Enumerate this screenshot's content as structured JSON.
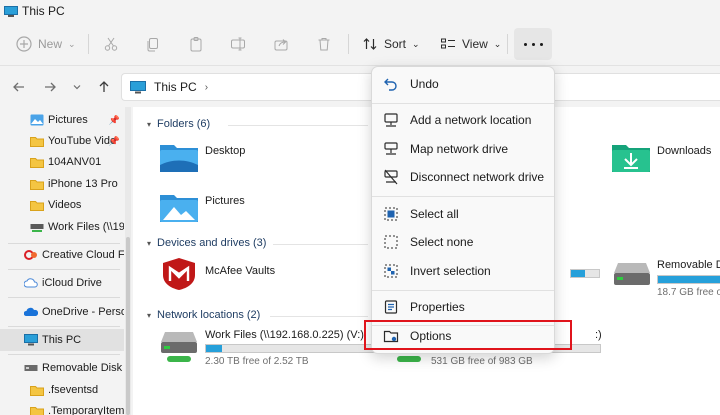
{
  "window": {
    "title": "This PC"
  },
  "toolbar": {
    "new_label": "New",
    "sort_label": "Sort",
    "view_label": "View"
  },
  "address": {
    "crumb": "This PC"
  },
  "sidebar": {
    "items": [
      {
        "label": "Pictures",
        "icon": "pictures-folder-icon"
      },
      {
        "label": "YouTube Vide",
        "icon": "folder-icon"
      },
      {
        "label": "104ANV01",
        "icon": "folder-icon"
      },
      {
        "label": "iPhone 13 Pro",
        "icon": "folder-icon"
      },
      {
        "label": "Videos",
        "icon": "folder-icon"
      },
      {
        "label": "Work Files (\\\\192",
        "icon": "network-drive-icon"
      },
      {
        "label": "Creative Cloud Fil",
        "icon": "creative-cloud-icon"
      },
      {
        "label": "iCloud Drive",
        "icon": "icloud-icon"
      },
      {
        "label": "OneDrive - Persor",
        "icon": "onedrive-icon"
      },
      {
        "label": "This PC",
        "icon": "this-pc-icon"
      },
      {
        "label": "Removable Disk (I",
        "icon": "removable-disk-icon"
      },
      {
        "label": ".fseventsd",
        "icon": "folder-icon"
      },
      {
        "label": ".TemporaryItems",
        "icon": "folder-icon"
      }
    ]
  },
  "content": {
    "folders_header": "Folders (6)",
    "devices_header": "Devices and drives (3)",
    "network_header": "Network locations (2)",
    "desktop": "Desktop",
    "downloads": "Downloads",
    "pictures": "Pictures",
    "mcafee": "McAfee Vaults",
    "removable": "Removable D",
    "removable_free": "18.7 GB free o",
    "removable_fill": 0.9,
    "workfiles": "Work Files (\\\\192.168.0.225) (V:)",
    "workfiles_free": "2.30 TB free of 2.52 TB",
    "workfiles_fill": 0.09,
    "drive2_name": ":)",
    "drive2_free": "531 GB free of 983 GB",
    "drive2_fill": 0.46,
    "drive_top_fill": 0.5
  },
  "menu": {
    "undo": "Undo",
    "add_network": "Add a network location",
    "map_drive": "Map network drive",
    "disconnect": "Disconnect network drive",
    "select_all": "Select all",
    "select_none": "Select none",
    "invert": "Invert selection",
    "properties": "Properties",
    "options": "Options"
  },
  "colors": {
    "accent": "#0067c0",
    "highlight": "#e0141c",
    "progress": "#26a0da"
  }
}
